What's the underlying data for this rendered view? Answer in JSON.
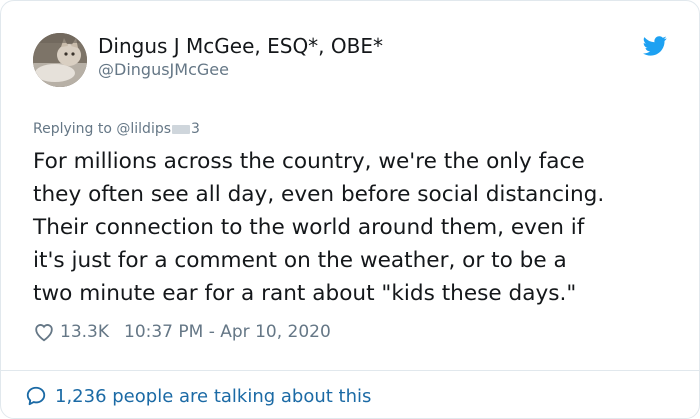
{
  "author": {
    "display_name": "Dingus J McGee, ESQ*, OBE*",
    "handle": "@DingusJMcGee"
  },
  "reply": {
    "prefix": "Replying to",
    "handle_start": "@lildips",
    "handle_end": "3"
  },
  "tweet": {
    "text": "For millions across the country, we're the only face\nthey often see all day, even before social distancing.\nTheir connection to the world around them, even if\nit's just for a comment on the weather, or to be a\ntwo minute ear for a rant about \"kids these days.\""
  },
  "meta": {
    "likes": "13.3K",
    "timestamp": "10:37 PM - Apr 10, 2020"
  },
  "footer": {
    "talking_text": "1,236 people are talking about this"
  },
  "icons": {
    "logo": "twitter-bird-icon",
    "like": "heart-icon",
    "talking": "speech-bubble-icon"
  },
  "colors": {
    "brand_blue": "#1da1f2",
    "link_blue": "#1b6aa5",
    "secondary_text": "#657786",
    "border": "#e1e8ed"
  }
}
